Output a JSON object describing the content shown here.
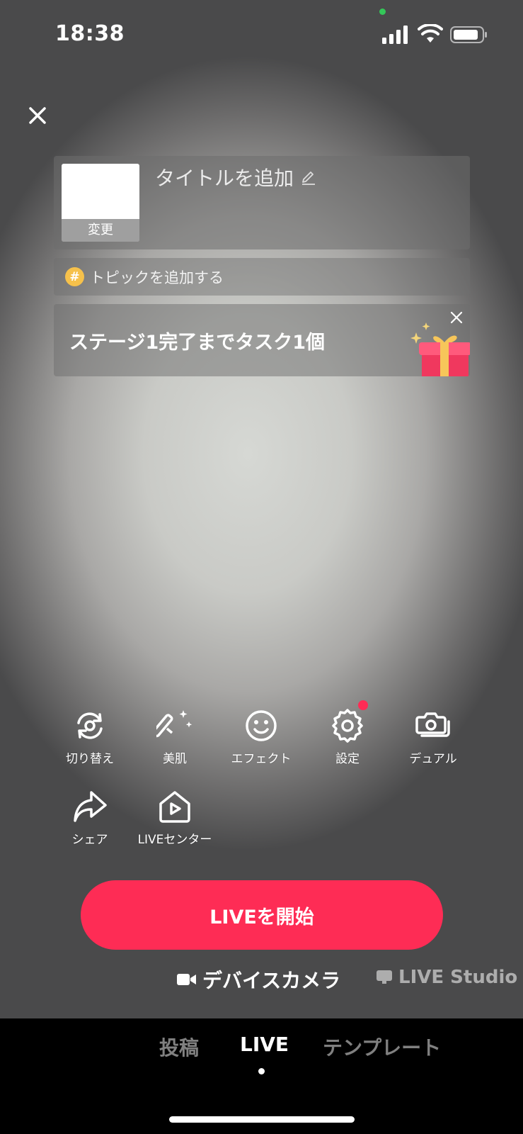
{
  "status_bar": {
    "time": "18:38",
    "icons": [
      "signal-icon",
      "wifi-icon",
      "battery-icon"
    ]
  },
  "close_icon": "close-icon",
  "title_card": {
    "cover_change_label": "変更",
    "title_placeholder": "タイトルを追加",
    "edit_icon": "pencil-icon"
  },
  "topic": {
    "icon": "hashtag-icon",
    "label": "トピックを追加する"
  },
  "task_banner": {
    "text": "ステージ1完了までタスク1個",
    "icon": "gift-icon"
  },
  "tools": [
    {
      "label": "切り替え",
      "icon": "flip-camera-icon"
    },
    {
      "label": "美肌",
      "icon": "magic-wand-icon"
    },
    {
      "label": "エフェクト",
      "icon": "smiley-icon"
    },
    {
      "label": "設定",
      "icon": "gear-icon",
      "badge": true
    },
    {
      "label": "デュアル",
      "icon": "dual-camera-icon"
    },
    {
      "label": "シェア",
      "icon": "share-icon"
    },
    {
      "label": "LIVEセンター",
      "icon": "live-center-icon"
    }
  ],
  "go_live_label": "LIVEを開始",
  "sources": {
    "camera_label": "デバイスカメラ",
    "studio_label": "LIVE Studio"
  },
  "mode_tabs": [
    {
      "label": "投稿",
      "active": false
    },
    {
      "label": "LIVE",
      "active": true
    },
    {
      "label": "テンプレート",
      "active": false
    }
  ],
  "colors": {
    "accent": "#fe2c55",
    "status_green": "#34c759",
    "topic_badge": "#f6c14b"
  }
}
